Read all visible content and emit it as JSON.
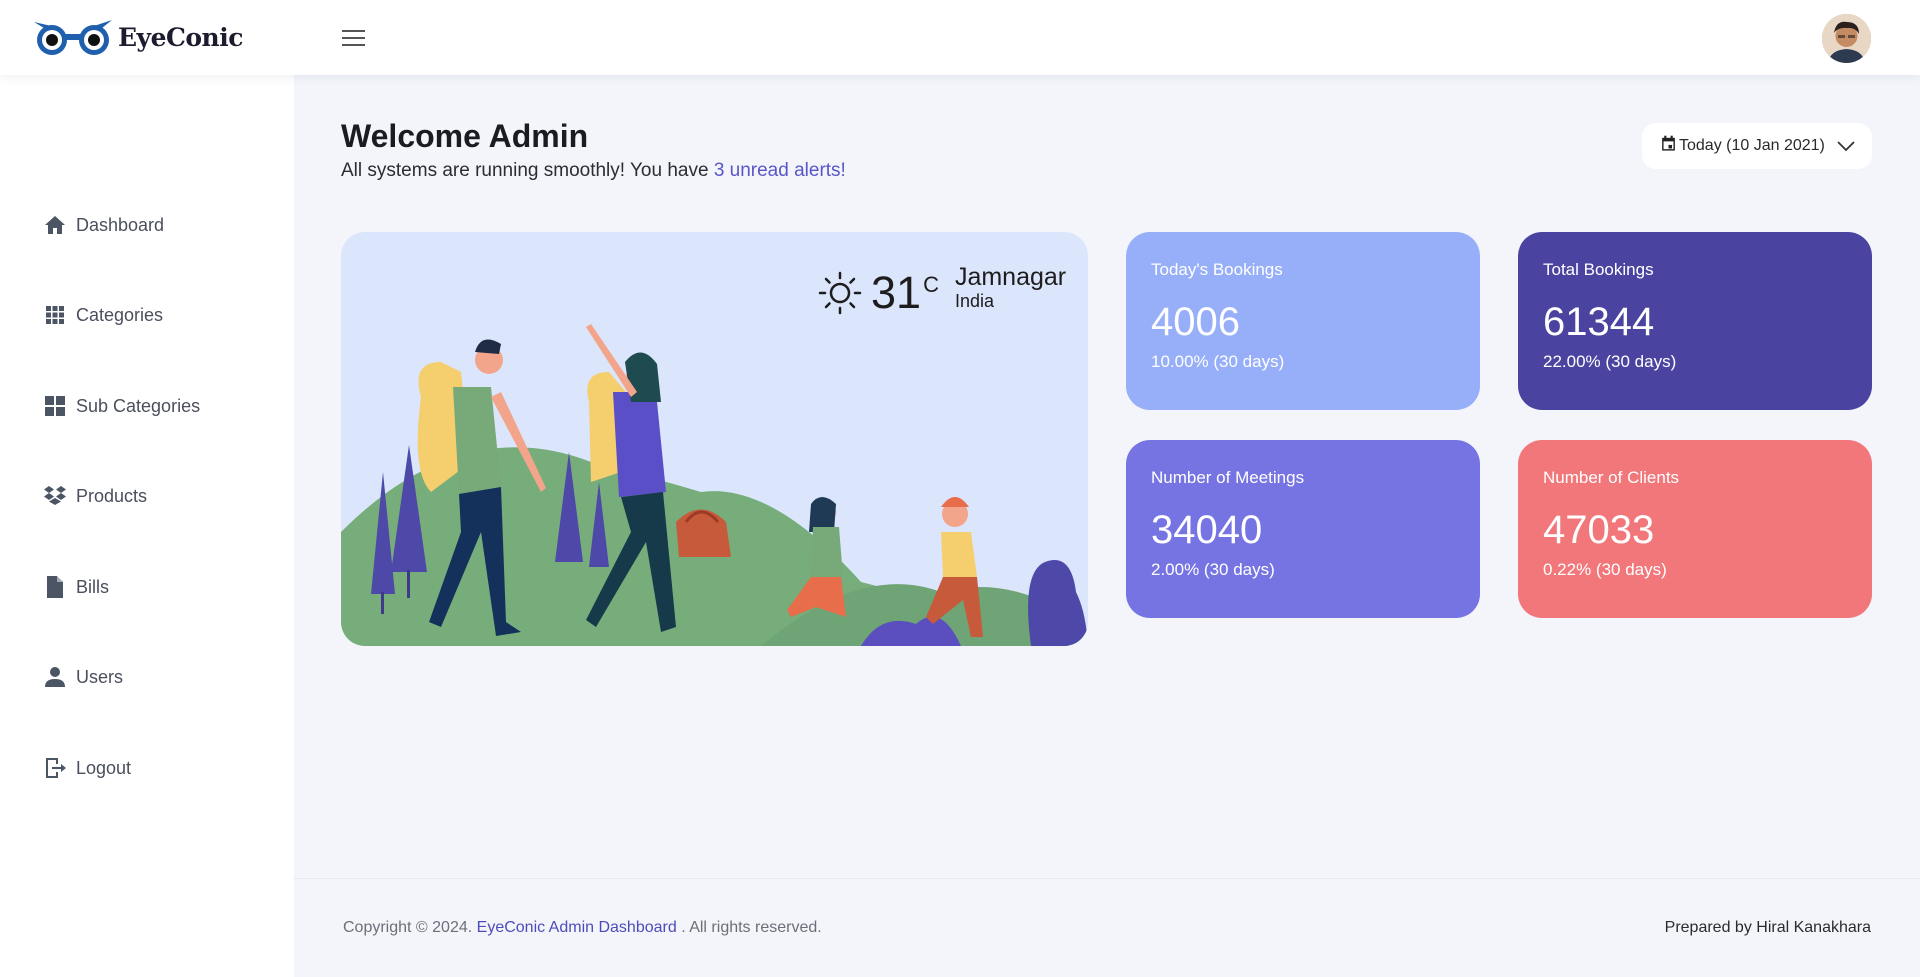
{
  "header": {
    "brand": "EyeConic",
    "menu_label": "Toggle sidebar"
  },
  "sidebar": {
    "items": [
      {
        "label": "Dashboard",
        "icon": "home-icon"
      },
      {
        "label": "Categories",
        "icon": "grid-icon"
      },
      {
        "label": "Sub Categories",
        "icon": "dashboard-icon"
      },
      {
        "label": "Products",
        "icon": "dropbox-icon"
      },
      {
        "label": "Bills",
        "icon": "file-icon"
      },
      {
        "label": "Users",
        "icon": "user-icon"
      },
      {
        "label": "Logout",
        "icon": "logout-icon"
      }
    ]
  },
  "welcome": {
    "title": "Welcome Admin",
    "subtitle_prefix": "All systems are running smoothly! You have ",
    "alert_link": "3 unread alerts!"
  },
  "date_filter": {
    "label": "Today (10 Jan 2021)"
  },
  "weather": {
    "temperature": "31",
    "unit": "C",
    "city": "Jamnagar",
    "country": "India"
  },
  "stats": [
    {
      "title": "Today's Bookings",
      "value": "4006",
      "change": "10.00% (30 days)",
      "color": "#97aff8"
    },
    {
      "title": "Total Bookings",
      "value": "61344",
      "change": "22.00% (30 days)",
      "color": "#4a44a0"
    },
    {
      "title": "Number of Meetings",
      "value": "34040",
      "change": "2.00% (30 days)",
      "color": "#7674e3"
    },
    {
      "title": "Number of Clients",
      "value": "47033",
      "change": "0.22% (30 days)",
      "color": "#f2777b"
    }
  ],
  "footer": {
    "copyright_prefix": "Copyright © 2024. ",
    "copyright_link": "EyeConic Admin Dashboard",
    "copyright_suffix": " . All rights reserved.",
    "prepared_by": "Prepared by Hiral Kanakhara"
  },
  "colors": {
    "accent": "#5856c8",
    "sidebar_bg": "#ffffff",
    "page_bg": "#f3f5fb",
    "hero_bg": "#dbe5fb"
  }
}
